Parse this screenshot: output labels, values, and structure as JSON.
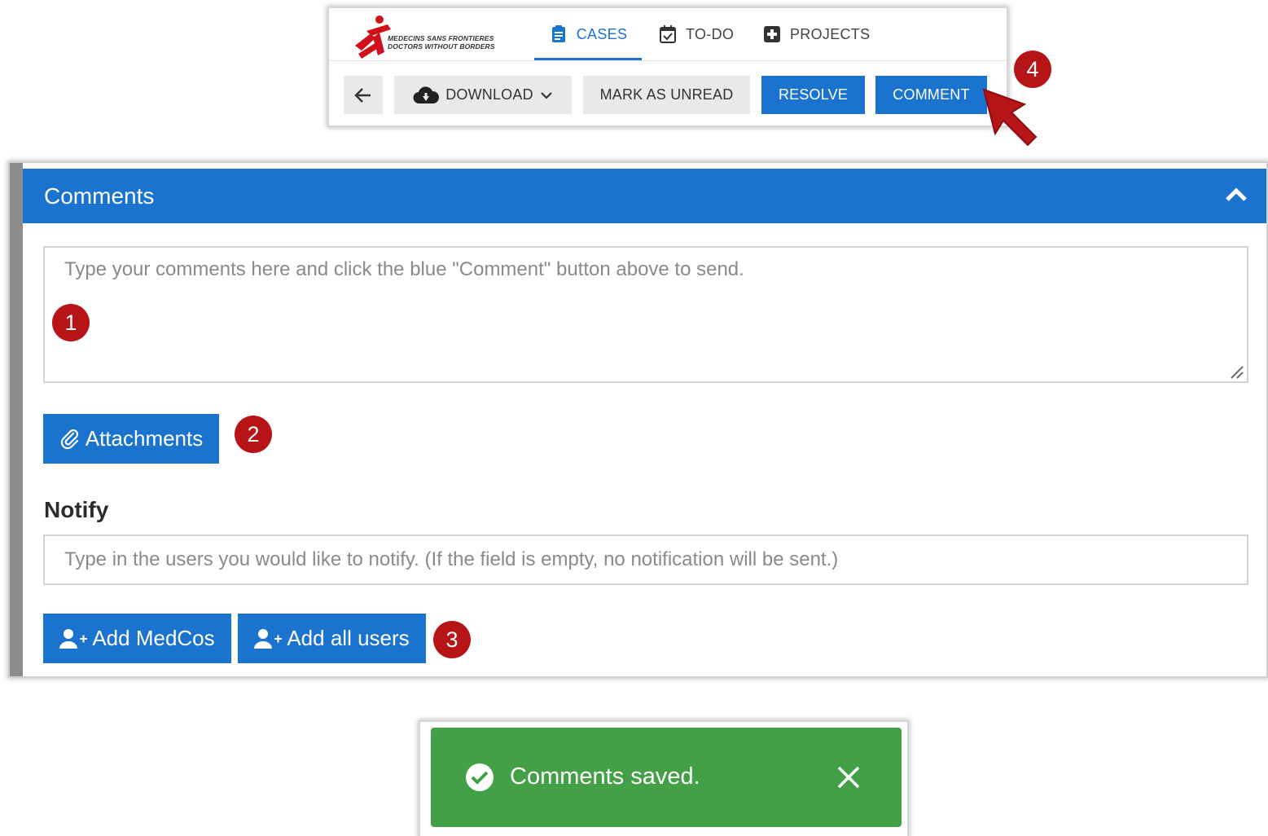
{
  "nav": {
    "logo_line1": "MEDECINS SANS FRONTIERES",
    "logo_line2": "DOCTORS WITHOUT BORDERS",
    "tabs": [
      {
        "label": "CASES",
        "icon": "clipboard-icon",
        "active": true
      },
      {
        "label": "TO-DO",
        "icon": "calendar-check-icon",
        "active": false
      },
      {
        "label": "PROJECTS",
        "icon": "plus-square-icon",
        "active": false
      }
    ]
  },
  "toolbar": {
    "back_icon": "arrow-left-icon",
    "download_label": "DOWNLOAD",
    "mark_unread_label": "MARK AS UNREAD",
    "resolve_label": "RESOLVE",
    "comment_label": "COMMENT"
  },
  "markers": [
    "1",
    "2",
    "3",
    "4"
  ],
  "comments": {
    "title": "Comments",
    "textarea_placeholder": "Type your comments here and click the blue \"Comment\" button above to send.",
    "textarea_value": "",
    "attachments_label": "Attachments",
    "notify_label": "Notify",
    "notify_placeholder": "Type in the users you would like to notify. (If the field is empty, no notification will be sent.)",
    "notify_value": "",
    "add_medcos_label": "Add MedCos",
    "add_all_users_label": "Add all users"
  },
  "toast": {
    "message": "Comments saved.",
    "ghost_text": "..........."
  },
  "colors": {
    "primary_blue": "#1a73cf",
    "marker_red": "#b71418",
    "success_green": "#43a047",
    "button_grey": "#e9e9e9",
    "logo_red": "#d0111b"
  }
}
